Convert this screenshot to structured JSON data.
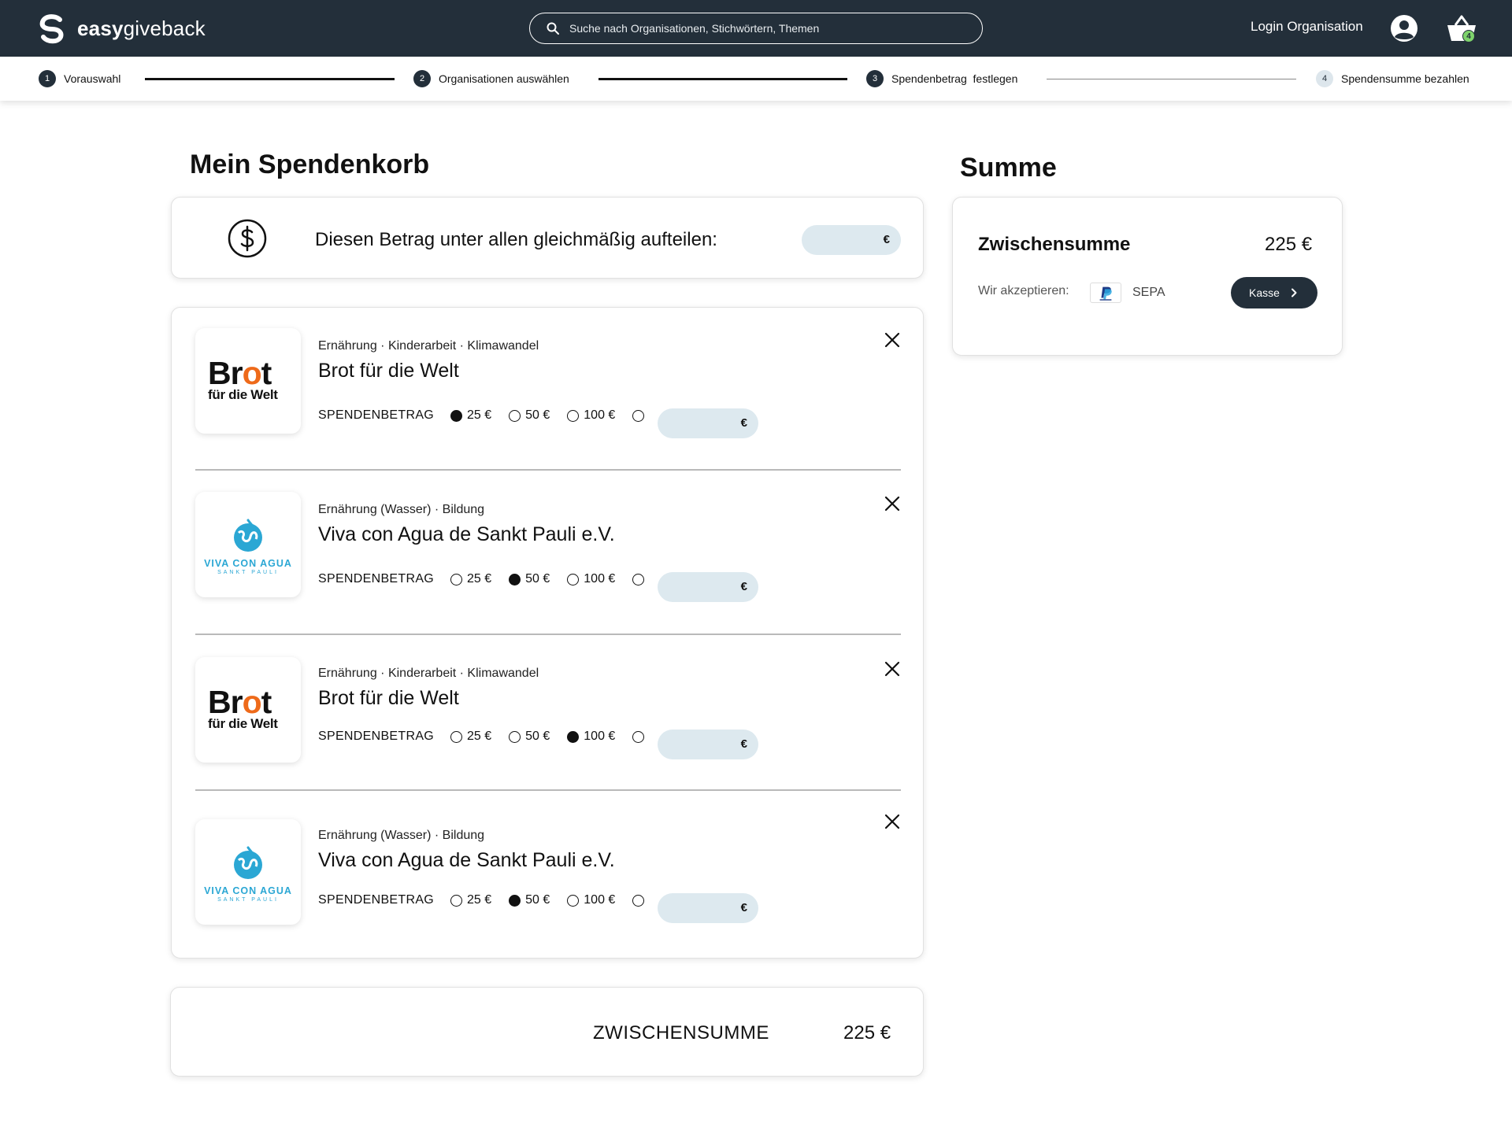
{
  "header": {
    "brand_bold": "easy",
    "brand_rest": "giveback",
    "search_placeholder": "Suche nach Organisationen, Stichwörtern, Themen",
    "login_label": "Login Organisation",
    "cart_count": "4"
  },
  "stepper": [
    {
      "num": "1",
      "label": "Vorauswahl"
    },
    {
      "num": "2",
      "label": "Organisationen auswählen"
    },
    {
      "num": "3",
      "label": "Spendenbetrag  festlegen"
    },
    {
      "num": "4",
      "label": "Spendensumme bezahlen"
    }
  ],
  "basket": {
    "title": "Mein Spendenkorb",
    "split_text": "Diesen Betrag unter allen gleichmäßig aufteilen:",
    "currency": "€",
    "amount_label": "SPENDENBETRAG",
    "options": [
      "25 €",
      "50 €",
      "100 €"
    ],
    "items": [
      {
        "tags": "Ernährung · Kinderarbeit · Klimawandel",
        "name": "Brot für die Welt",
        "logo": "brot",
        "selected": "25 €"
      },
      {
        "tags": "Ernährung (Wasser) · Bildung",
        "name": "Viva con Agua de Sankt Pauli e.V.",
        "logo": "viva",
        "selected": "50 €"
      },
      {
        "tags": "Ernährung · Kinderarbeit · Klimawandel",
        "name": "Brot für die Welt",
        "logo": "brot",
        "selected": "100 €"
      },
      {
        "tags": "Ernährung (Wasser) · Bildung",
        "name": "Viva con Agua de Sankt Pauli e.V.",
        "logo": "viva",
        "selected": "50 €"
      }
    ],
    "subtotal_label": "ZWISCHENSUMME",
    "subtotal_value": "225 €"
  },
  "logos": {
    "brot_top_a": "Br",
    "brot_top_o": "o",
    "brot_top_b": "t",
    "brot_bottom": "für die Welt",
    "viva_top": "VIVA CON AGUA",
    "viva_bottom": "SANKT PAULI"
  },
  "summary": {
    "title": "Summe",
    "subtotal_label": "Zwischensumme",
    "subtotal_value": "225 €",
    "accept_label": "Wir akzeptieren:",
    "sepa": "SEPA",
    "checkout_label": "Kasse"
  },
  "colors": {
    "navbar": "#232f3a",
    "pill": "#dde9ef",
    "brot_orange": "#ee6a1a",
    "viva_blue": "#2ba7d4",
    "badge_green": "#7ed36b"
  },
  "icons": [
    "logo-mark-icon",
    "search-icon",
    "user-icon",
    "cart-icon",
    "dollar-icon",
    "close-icon",
    "paypal-icon",
    "chevron-right-icon"
  ]
}
